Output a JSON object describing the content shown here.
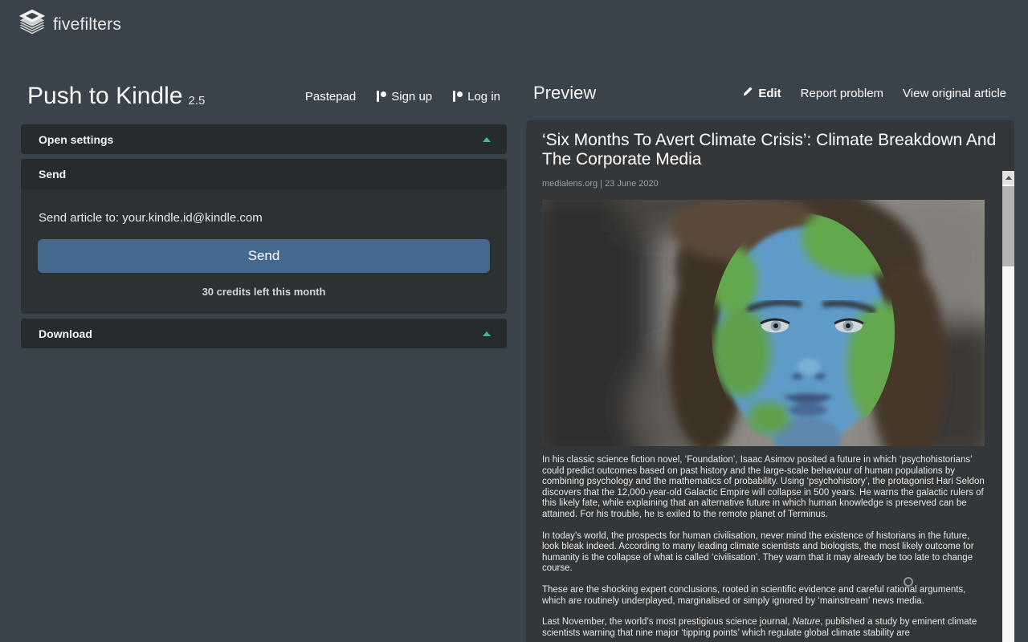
{
  "brand": {
    "name": "fivefilters"
  },
  "app": {
    "title": "Push to Kindle",
    "version": "2.5"
  },
  "nav": {
    "pastepad": "Pastepad",
    "signup": "Sign up",
    "login": "Log in"
  },
  "settings": {
    "open_settings_label": "Open settings",
    "send": {
      "header": "Send",
      "send_to_label": "Send article to: your.kindle.id@kindle.com",
      "send_button": "Send",
      "credits": "30 credits left this month"
    },
    "download_label": "Download"
  },
  "preview": {
    "heading": "Preview",
    "actions": {
      "edit": "Edit",
      "report_problem": "Report problem",
      "view_original": "View original article"
    },
    "article": {
      "title": "‘Six Months To Avert Climate Crisis’: Climate Breakdown And The Corporate Media",
      "source_line": "medialens.org | 23 June 2020",
      "paragraphs": [
        "In his classic science fiction novel, ‘Foundation’, Isaac Asimov posited a future in which ‘psychohistorians’ could predict outcomes based on past history and the large-scale behaviour of human populations by combining psychology and the mathematics of probability. Using ‘psychohistory’, the protagonist Hari Seldon discovers that the 12,000-year-old Galactic Empire will collapse in 500 years. He warns the galactic rulers of this likely fate, while explaining that an alternative future in which human knowledge is preserved can be attained. For his trouble, he is exiled to the remote planet of Terminus.",
        "In today’s world, the prospects for human civilisation, never mind the existence of historians in the future, look bleak indeed. According to many leading climate scientists and biologists, the most likely outcome for humanity is the collapse of what is called ‘civilisation’. They warn that it may already be too late to change course.",
        "These are the shocking expert conclusions, rooted in scientific evidence and careful rational arguments, which are routinely underplayed, marginalised or simply ignored by ‘mainstream’ news media."
      ],
      "paragraph4": {
        "before_italic": "Last November, the world’s most prestigious science journal, ",
        "italic": "Nature",
        "after_italic": ", published a study by eminent climate scientists warning that nine major ‘tipping points’ which regulate global climate stability are"
      }
    }
  },
  "colors": {
    "page_background": "#39434B",
    "panel_header": "#262B2E",
    "panel_body": "#2C3134",
    "article_background": "#343739",
    "accent_green": "#3DBD8F",
    "send_button_blue": "#45688E"
  }
}
